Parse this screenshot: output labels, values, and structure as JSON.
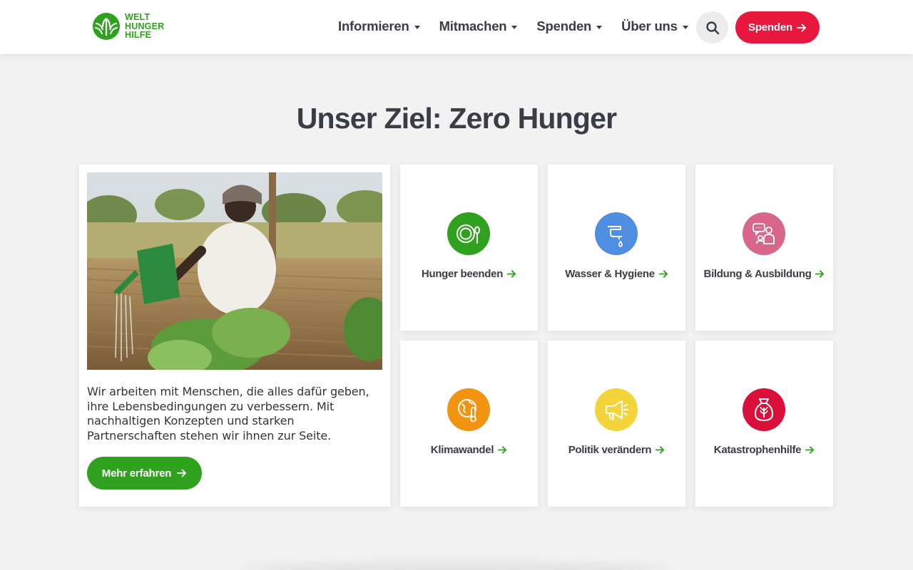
{
  "header": {
    "logo": {
      "line1": "WELT",
      "line2": "HUNGER",
      "line3": "HILFE"
    },
    "nav": [
      {
        "label": "Informieren"
      },
      {
        "label": "Mitmachen"
      },
      {
        "label": "Spenden"
      },
      {
        "label": "Über uns"
      }
    ],
    "donate_label": "Spenden"
  },
  "main": {
    "title": "Unser Ziel: Zero Hunger",
    "feature": {
      "text": "Wir arbeiten mit Menschen, die alles dafür geben, ihre Lebensbedingungen zu verbessern. Mit nachhaltigen Konzepten und starken Partnerschaften stehen wir ihnen zur Seite.",
      "button_label": "Mehr erfahren"
    },
    "topics": [
      {
        "label": "Hunger beenden",
        "icon": "plate-cutlery-icon",
        "color": "#2fa11e"
      },
      {
        "label": "Wasser & Hygiene",
        "icon": "water-tap-icon",
        "color": "#4f8ee0"
      },
      {
        "label": "Bildung & Ausbildung",
        "icon": "people-chat-icon",
        "color": "#d9678a"
      },
      {
        "label": "Klimawandel",
        "icon": "globe-thermometer-icon",
        "color": "#f39312"
      },
      {
        "label": "Politik verändern",
        "icon": "megaphone-icon",
        "color": "#f3d43a"
      },
      {
        "label": "Katastrophenhilfe",
        "icon": "grain-sack-icon",
        "color": "#d9103a"
      }
    ]
  },
  "colors": {
    "brand_green": "#2fa11e",
    "donate_red": "#e8173d",
    "text_dark": "#3c3c46",
    "background": "#f2f2f2"
  }
}
